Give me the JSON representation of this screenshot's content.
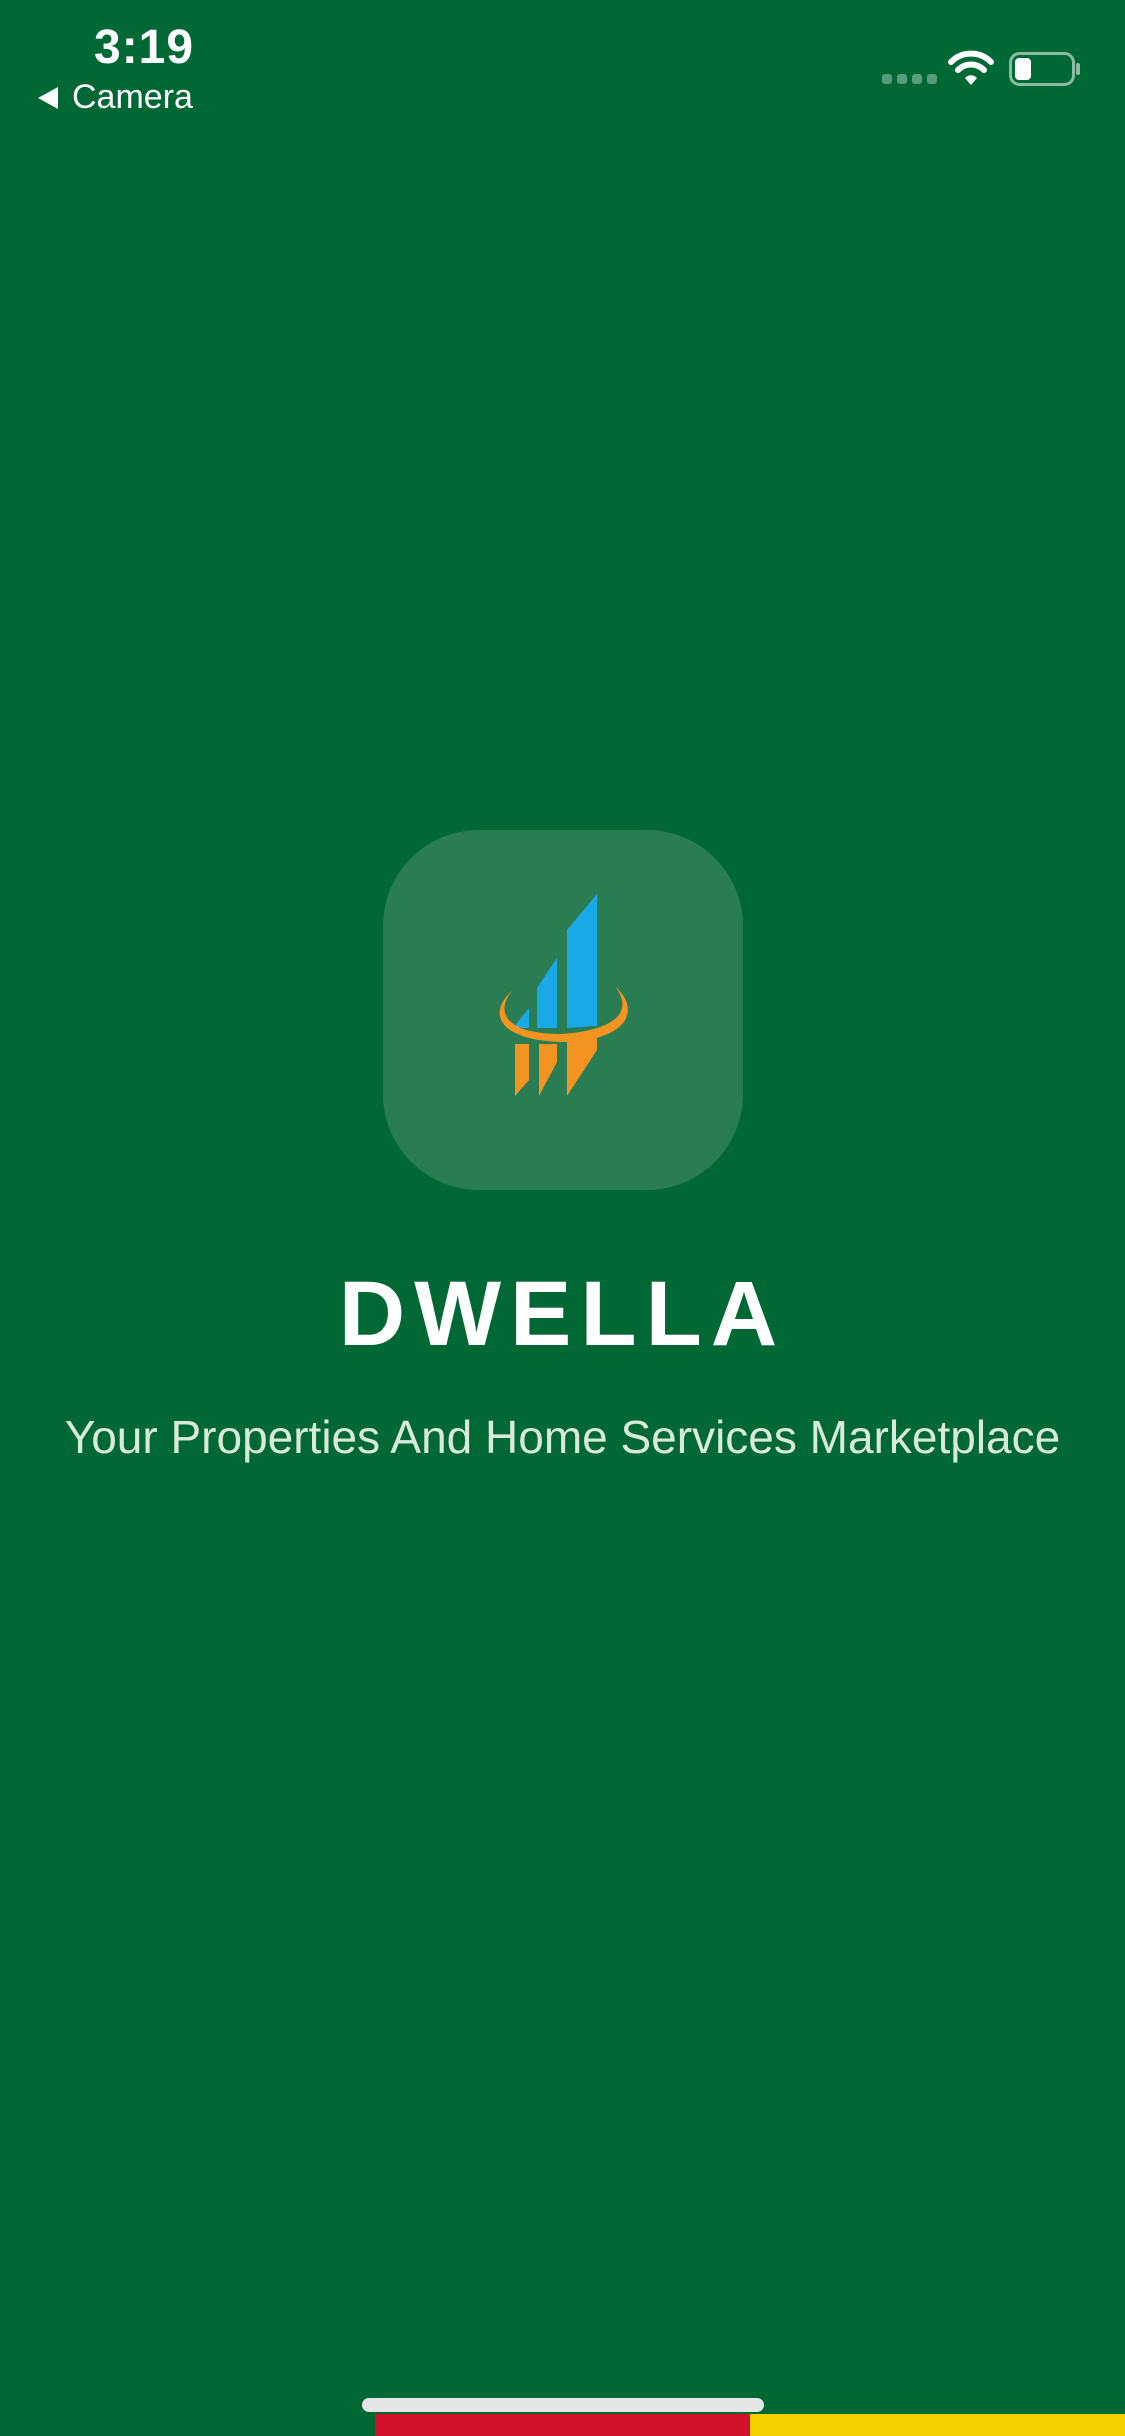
{
  "status_bar": {
    "time": "3:19",
    "back_label": "Camera",
    "signal_icon": "signal-dots-icon",
    "wifi_icon": "wifi-icon",
    "battery_icon": "battery-icon",
    "battery_level": 0.3
  },
  "splash": {
    "logo_icon": "building-chart-logo-icon",
    "app_name": "DWELLA",
    "tagline": "Your Properties And Home Services Marketplace"
  },
  "colors": {
    "background": "#006835",
    "logo_tile": "#2a7d53",
    "logo_blue": "#18a9e6",
    "logo_orange": "#f39322",
    "stripe_red": "#d1122b",
    "stripe_yellow": "#f6d100"
  }
}
